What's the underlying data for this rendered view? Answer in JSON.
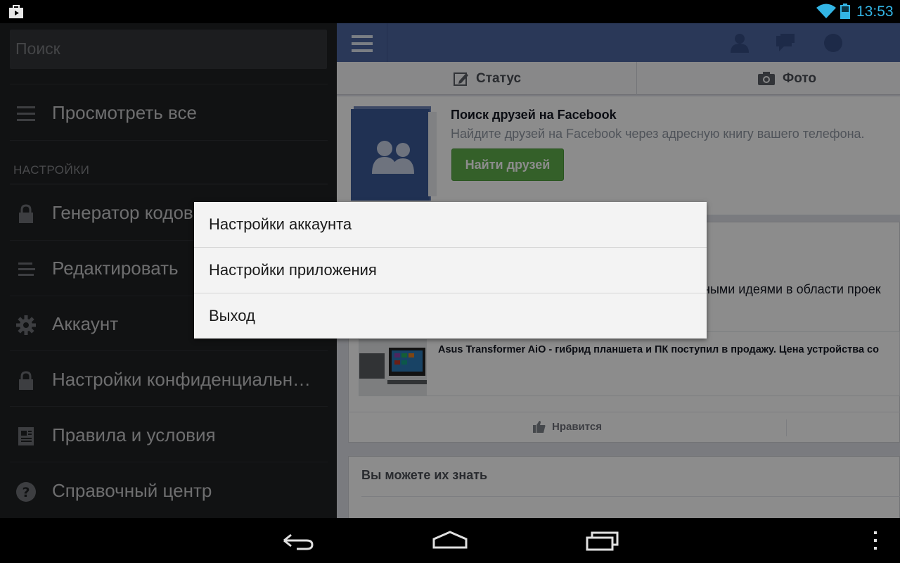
{
  "status_bar": {
    "time": "13:53",
    "accent_color": "#33b5e5",
    "icons": [
      "play-store-icon",
      "wifi-icon",
      "battery-icon"
    ]
  },
  "drawer": {
    "search_placeholder": "Поиск",
    "view_all": "Просмотреть все",
    "section_settings": "НАСТРОЙКИ",
    "items": [
      {
        "label": "Генератор кодов",
        "icon": "lock-icon"
      },
      {
        "label": "Редактировать",
        "icon": "list-icon"
      },
      {
        "label": "Аккаунт",
        "icon": "gear-icon"
      },
      {
        "label": "Настройки конфиденциальн…",
        "icon": "lock-icon"
      },
      {
        "label": "Правила и условия",
        "icon": "document-icon"
      },
      {
        "label": "Справочный центр",
        "icon": "help-icon"
      }
    ]
  },
  "feed": {
    "brand_color": "#4e67a1",
    "composer": {
      "status": "Статус",
      "photo": "Фото"
    },
    "find_friends": {
      "title": "Поиск друзей на Facebook",
      "subtitle": "Найдите друзей на Facebook через адресную книгу вашего телефона.",
      "button": "Найти друзей"
    },
    "post_text_partial": "ными идеями в области проек",
    "link_title": "Asus Transformer AiO - гибрид планшета и ПК поступил в продажу. Цена устройства со",
    "like_label": "Нравится",
    "people_you_may_know": "Вы можете их знать"
  },
  "context_menu": {
    "items": [
      "Настройки аккаунта",
      "Настройки приложения",
      "Выход"
    ]
  },
  "nav_bar": {
    "icons": [
      "back-icon",
      "home-icon",
      "recent-apps-icon",
      "overflow-menu-icon"
    ]
  }
}
